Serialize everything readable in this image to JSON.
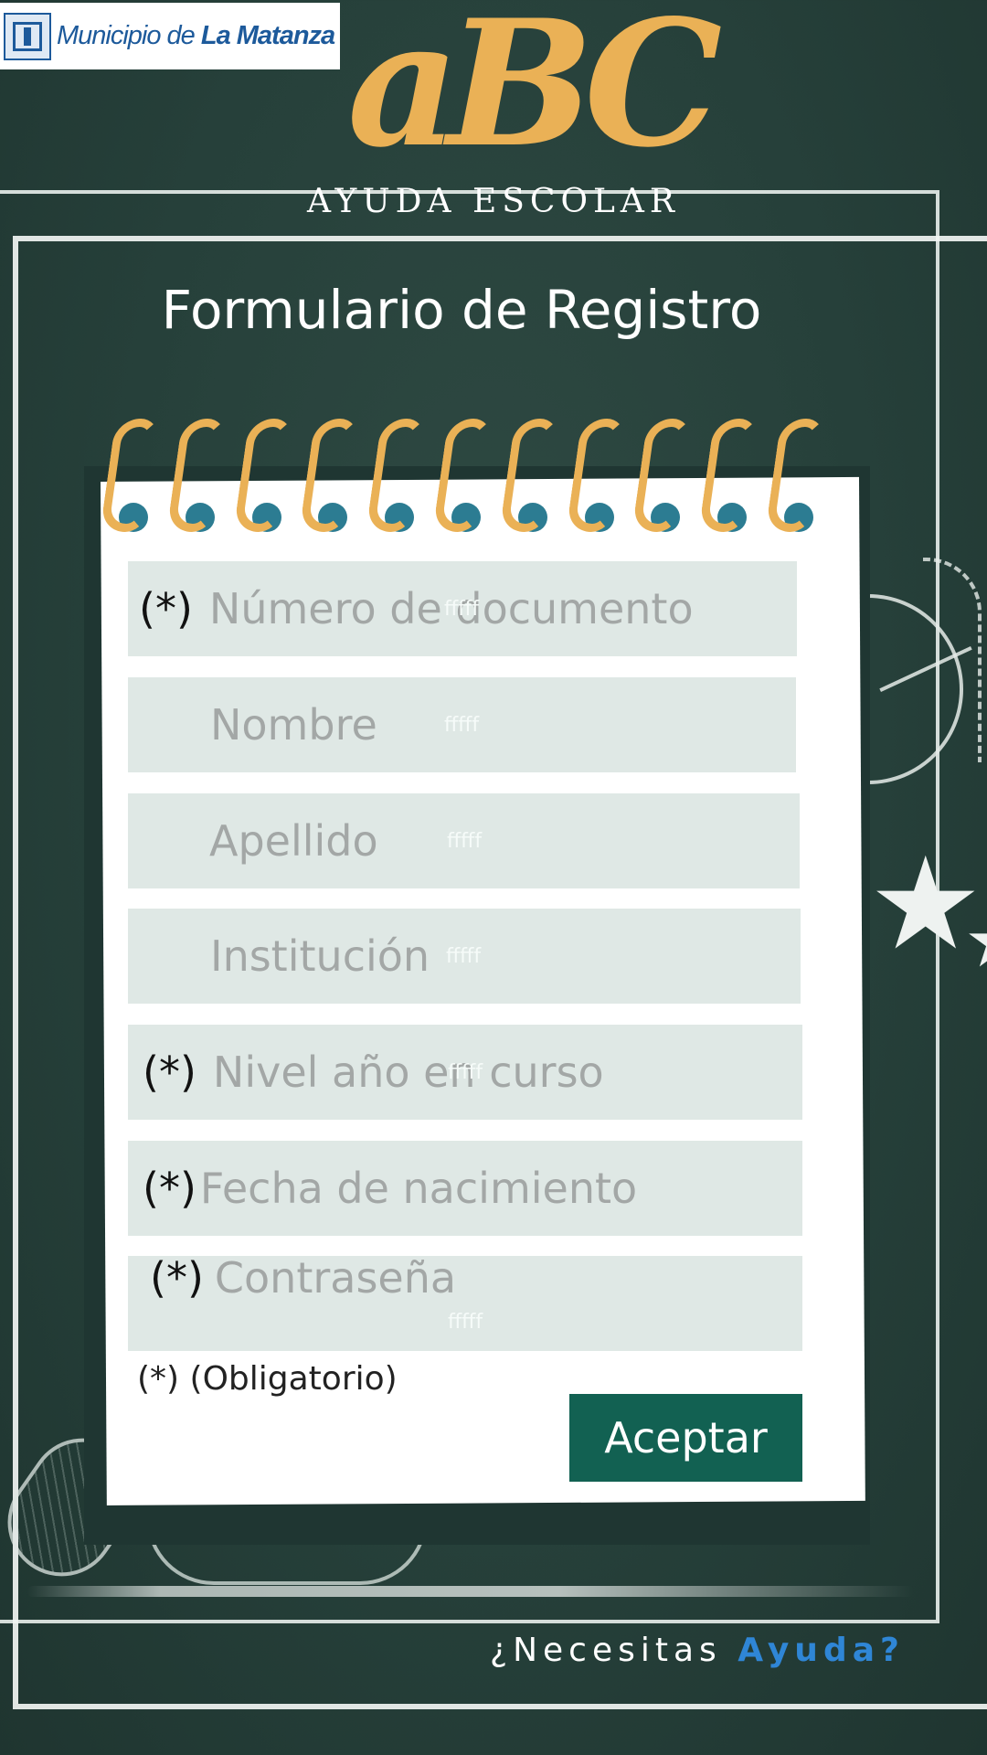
{
  "header": {
    "logo_prefix": "Municipio de ",
    "logo_bold": "La Matanza",
    "brand": "aBC",
    "tagline": "AYUDA ESCOLAR"
  },
  "form": {
    "title": "Formulario de Registro",
    "fields": [
      {
        "required_mark": "(*)",
        "placeholder": "Número de documento",
        "ghost": "fffff"
      },
      {
        "required_mark": "",
        "placeholder": "Nombre",
        "ghost": "fffff"
      },
      {
        "required_mark": "",
        "placeholder": "Apellido",
        "ghost": "fffff"
      },
      {
        "required_mark": "",
        "placeholder": "Institución",
        "ghost": "fffff"
      },
      {
        "required_mark": "(*)",
        "placeholder": "Nivel año en curso",
        "ghost": "fffff"
      },
      {
        "required_mark": "(*)",
        "placeholder": "Fecha de nacimiento",
        "ghost": ""
      },
      {
        "required_mark": "(*)",
        "placeholder": "Contraseña",
        "ghost": "fffff"
      }
    ],
    "required_note": "(*) (Obligatorio)",
    "submit_label": "Aceptar"
  },
  "footer": {
    "help_prefix": "¿Necesitas ",
    "help_link": "Ayuda?"
  },
  "colors": {
    "background": "#26403a",
    "brand": "#eab156",
    "field_bg": "#dfe8e5",
    "button": "#126152",
    "link": "#2f86d6"
  }
}
